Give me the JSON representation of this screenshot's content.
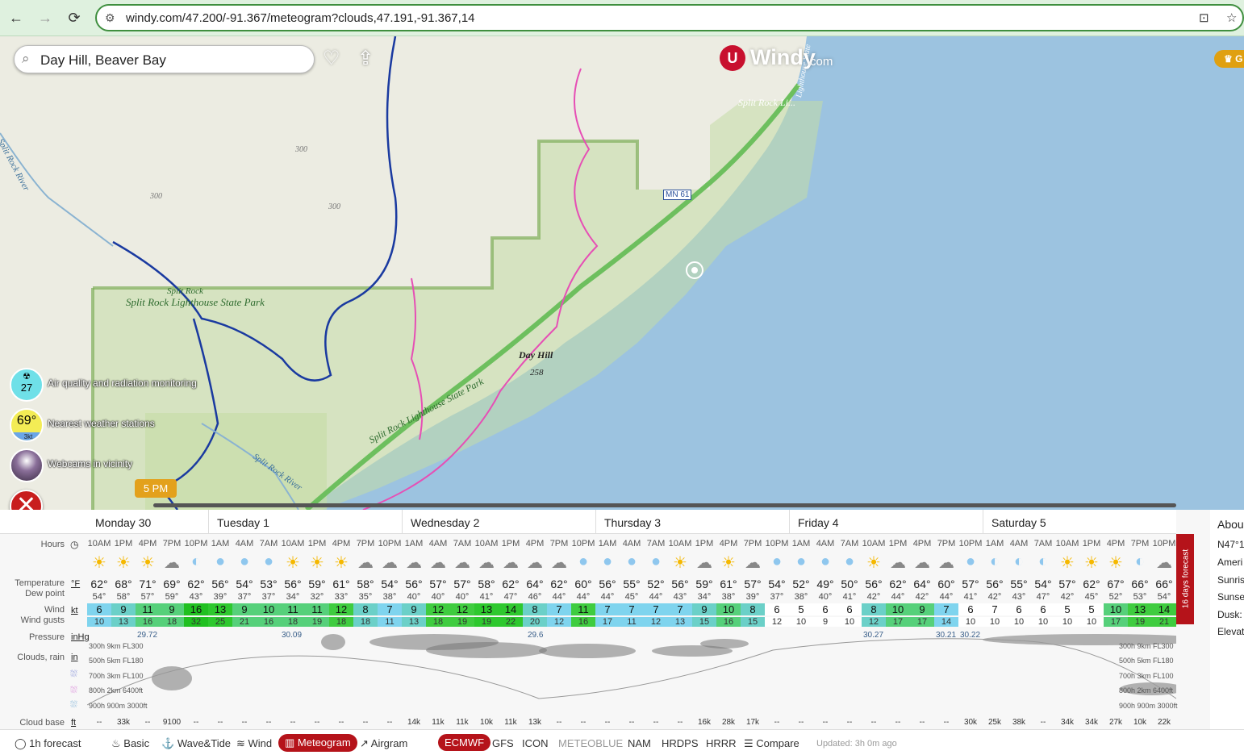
{
  "browser": {
    "url": "windy.com/47.200/-91.367/meteogram?clouds,47.191,-91.367,14",
    "back_icon": "←",
    "forward_icon": "→",
    "reload_icon": "⟳",
    "site_icon": "⚙",
    "install_icon": "⊡",
    "star_icon": "☆"
  },
  "search": {
    "value": "Day Hill, Beaver Bay",
    "icon": "⌕"
  },
  "heart_icon": "♡",
  "share_icon": "⇪",
  "logo": {
    "name": "Windy",
    "domain": "com"
  },
  "premium": {
    "label": "♛ G"
  },
  "map_labels": {
    "park1": "Split Rock Lighthouse State Park",
    "park1_small": "Split Rock",
    "park2": "Split Rock Lighthouse State Park",
    "river1": "Split Rock River",
    "river2": "Split Rock River",
    "lighthouse": "Split Rock Li...",
    "highway": "MN 61",
    "hill": "Day Hill",
    "hill_elev": "258",
    "c300a": "300",
    "c300b": "300",
    "c300c": "300",
    "lighthouse_state": "Lighthouse State"
  },
  "side_buttons": [
    {
      "value": "27",
      "label": "Air quality and radiation monitoring",
      "icon": "☢"
    },
    {
      "value": "69°",
      "sub": "3kt",
      "label": "Nearest weather stations"
    },
    {
      "label": "Webcams in vicinity"
    }
  ],
  "close_icon": "✕",
  "time_marker": "5 PM",
  "days": [
    "Monday 30",
    "Tuesday 1",
    "Wednesday 2",
    "Thursday 3",
    "Friday 4",
    "Saturday 5"
  ],
  "row_labels": {
    "hours": "Hours",
    "temperature": "Temperature",
    "dew": "Dew point",
    "wind": "Wind",
    "gusts": "Wind gusts",
    "pressure": "Pressure",
    "clouds": "Clouds, rain",
    "cloudbase": "Cloud base"
  },
  "units": {
    "temp": "°F",
    "wind": "kt",
    "pressure": "inHg",
    "clouds": "in",
    "cloudbase": "ft"
  },
  "hours": [
    "10AM",
    "1PM",
    "4PM",
    "7PM",
    "10PM",
    "1AM",
    "4AM",
    "7AM",
    "10AM",
    "1PM",
    "4PM",
    "7PM",
    "10PM",
    "1AM",
    "4AM",
    "7AM",
    "10AM",
    "1PM",
    "4PM",
    "7PM",
    "10PM",
    "1AM",
    "4AM",
    "7AM",
    "10AM",
    "1PM",
    "4PM",
    "7PM",
    "10PM",
    "1AM",
    "4AM",
    "7AM",
    "10AM",
    "1PM",
    "4PM",
    "7PM",
    "10PM",
    "1AM",
    "4AM",
    "7AM",
    "10AM",
    "1PM",
    "4PM",
    "7PM",
    "10PM"
  ],
  "temps": [
    "62°",
    "68°",
    "71°",
    "69°",
    "62°",
    "56°",
    "54°",
    "53°",
    "56°",
    "59°",
    "61°",
    "58°",
    "54°",
    "56°",
    "57°",
    "57°",
    "58°",
    "62°",
    "64°",
    "62°",
    "60°",
    "56°",
    "55°",
    "52°",
    "56°",
    "59°",
    "61°",
    "57°",
    "54°",
    "52°",
    "49°",
    "50°",
    "56°",
    "62°",
    "64°",
    "60°",
    "57°",
    "56°",
    "55°",
    "54°",
    "57°",
    "62°",
    "67°",
    "66°",
    "66°"
  ],
  "dews": [
    "54°",
    "58°",
    "57°",
    "59°",
    "43°",
    "39°",
    "37°",
    "37°",
    "34°",
    "32°",
    "33°",
    "35°",
    "38°",
    "40°",
    "40°",
    "40°",
    "41°",
    "47°",
    "46°",
    "44°",
    "44°",
    "44°",
    "45°",
    "44°",
    "43°",
    "34°",
    "38°",
    "39°",
    "37°",
    "38°",
    "40°",
    "41°",
    "42°",
    "44°",
    "42°",
    "44°",
    "41°",
    "42°",
    "43°",
    "47°",
    "42°",
    "45°",
    "52°",
    "53°",
    "54°"
  ],
  "winds": [
    "6",
    "9",
    "11",
    "9",
    "16",
    "13",
    "9",
    "10",
    "11",
    "11",
    "12",
    "8",
    "7",
    "9",
    "12",
    "12",
    "13",
    "14",
    "8",
    "7",
    "11",
    "7",
    "7",
    "7",
    "7",
    "9",
    "10",
    "8",
    "6",
    "5",
    "6",
    "6",
    "8",
    "10",
    "9",
    "7",
    "6",
    "7",
    "6",
    "6",
    "5",
    "5",
    "10",
    "13",
    "14"
  ],
  "gusts": [
    "10",
    "13",
    "16",
    "18",
    "32",
    "25",
    "21",
    "16",
    "18",
    "19",
    "18",
    "18",
    "11",
    "13",
    "18",
    "19",
    "19",
    "22",
    "20",
    "12",
    "16",
    "17",
    "11",
    "12",
    "13",
    "15",
    "16",
    "15",
    "12",
    "10",
    "9",
    "10",
    "12",
    "17",
    "17",
    "14",
    "10",
    "10",
    "10",
    "10",
    "10",
    "10",
    "17",
    "19",
    "21"
  ],
  "wind_colors": [
    "#7fd4ee",
    "#6bd0c8",
    "#56d07a",
    "#56d07a",
    "#20c020",
    "#2ec82e",
    "#56d07a",
    "#56d07a",
    "#56d07a",
    "#56d07a",
    "#3fcc3f",
    "#6bd0c8",
    "#7fd4ee",
    "#6bd0c8",
    "#3fcc3f",
    "#3fcc3f",
    "#2ec82e",
    "#2ec82e",
    "#6bd0c8",
    "#7fd4ee",
    "#3fcc3f",
    "#7fd4ee",
    "#7fd4ee",
    "#7fd4ee",
    "#7fd4ee",
    "#6bd0c8",
    "#56d07a",
    "#6bd0c8",
    "#fff",
    "#fff",
    "#fff",
    "#fff",
    "#6bd0c8",
    "#56d07a",
    "#56d07a",
    "#7fd4ee",
    "#fff",
    "#fff",
    "#fff",
    "#fff",
    "#fff",
    "#fff",
    "#56d07a",
    "#3fcc3f",
    "#3fcc3f"
  ],
  "weather_icons": [
    "☀",
    "☀",
    "☀",
    "☁",
    "◐",
    "●",
    "●",
    "●",
    "☀",
    "☀",
    "☀",
    "☁",
    "☁",
    "☁",
    "☁",
    "☁",
    "☁",
    "☁",
    "☁",
    "☁",
    "●",
    "●",
    "●",
    "●",
    "☀",
    "☁",
    "☀",
    "☁",
    "●",
    "●",
    "●",
    "●",
    "☀",
    "☁",
    "☁",
    "☁",
    "●",
    "◐",
    "◐",
    "◐",
    "☀",
    "☀",
    "☀",
    "◐",
    "☁"
  ],
  "pressure_values": [
    {
      "v": "29.72"
    },
    {
      "v": "30.09"
    },
    {
      "v": "29.6"
    },
    {
      "v": "30.27"
    },
    {
      "v": "30.21"
    },
    {
      "v": "30.22"
    }
  ],
  "levels": [
    "300h 9km FL300",
    "500h 5km FL180",
    "700h 3km FL100",
    "800h 2km 6400ft",
    "900h 900m 3000ft"
  ],
  "cloudbase": [
    "--",
    "33k",
    "--",
    "9100",
    "--",
    "--",
    "--",
    "--",
    "--",
    "--",
    "--",
    "--",
    "--",
    "14k",
    "11k",
    "11k",
    "10k",
    "11k",
    "13k",
    "--",
    "--",
    "--",
    "--",
    "--",
    "--",
    "16k",
    "28k",
    "17k",
    "--",
    "--",
    "--",
    "--",
    "--",
    "--",
    "--",
    "--",
    "30k",
    "25k",
    "38k",
    "--",
    "34k",
    "34k",
    "27k",
    "10k",
    "22k"
  ],
  "tab16": "16 days forecast",
  "about": {
    "title": "Abou",
    "lines": [
      "N47°1",
      "Ameri",
      "Sunris",
      "Sunse",
      "Dusk:",
      "Elevat"
    ]
  },
  "bottom": {
    "forecast": "1h forecast",
    "basic": "Basic",
    "wave": "Wave&Tide",
    "wind": "Wind",
    "meteogram": "Meteogram",
    "airgram": "Airgram",
    "models": [
      "ECMWF",
      "GFS",
      "ICON",
      "METEOBLUE",
      "NAM",
      "HRDPS",
      "HRRR"
    ],
    "compare": "Compare",
    "updated": "Updated: 3h 0m ago"
  }
}
